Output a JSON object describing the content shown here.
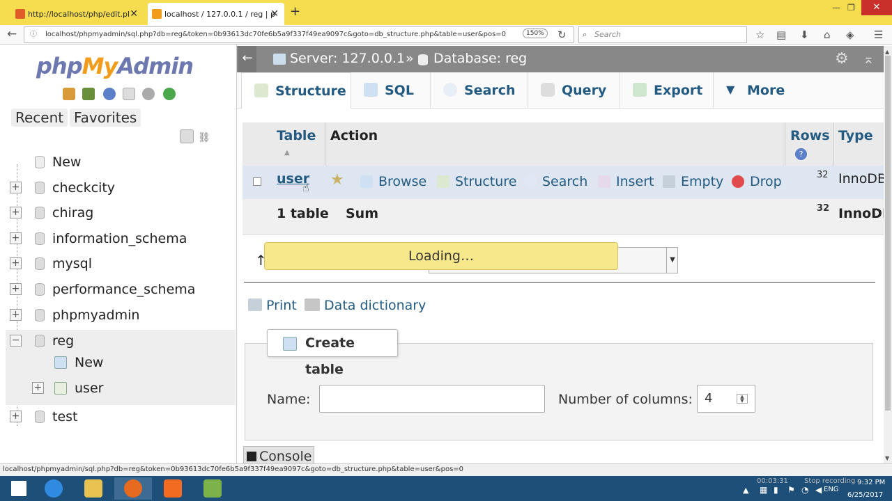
{
  "browser": {
    "tabs": [
      {
        "title": "http://localhost/php/edit.pl"
      },
      {
        "title": "localhost / 127.0.0.1 / reg | p"
      }
    ],
    "url": "localhost/phpmyadmin/sql.php?db=reg&token=0b93613dc70fe6b5a9f337f49ea9097c&goto=db_structure.php&table=user&pos=0",
    "zoom": "150%",
    "search_placeholder": "Search",
    "status_url": "localhost/phpmyadmin/sql.php?db=reg&token=0b93613dc70fe6b5a9f337f49ea9097c&goto=db_structure.php&table=user&pos=0"
  },
  "sidebar": {
    "logo": {
      "php": "php",
      "my": "My",
      "admin": "Admin"
    },
    "recent": "Recent",
    "favorites": "Favorites",
    "tree": [
      {
        "label": "New"
      },
      {
        "label": "checkcity"
      },
      {
        "label": "chirag"
      },
      {
        "label": "information_schema"
      },
      {
        "label": "mysql"
      },
      {
        "label": "performance_schema"
      },
      {
        "label": "phpmyadmin"
      },
      {
        "label": "reg"
      },
      {
        "label": "New"
      },
      {
        "label": "user"
      },
      {
        "label": "test"
      }
    ]
  },
  "breadcrumb": {
    "server": "Server: 127.0.0.1",
    "sep": "»",
    "database": "Database: reg"
  },
  "tabs": [
    {
      "label": "Structure"
    },
    {
      "label": "SQL"
    },
    {
      "label": "Search"
    },
    {
      "label": "Query"
    },
    {
      "label": "Export"
    },
    {
      "label": "More"
    }
  ],
  "table": {
    "headers": {
      "table": "Table",
      "action": "Action",
      "rows": "Rows",
      "type": "Type"
    },
    "row": {
      "name": "user",
      "actions": [
        "Browse",
        "Structure",
        "Search",
        "Insert",
        "Empty",
        "Drop"
      ],
      "rows": "32",
      "type": "InnoDB"
    },
    "footer": {
      "count": "1 table",
      "sum": "Sum",
      "rows": "32",
      "type": "InnoDB"
    }
  },
  "loading": "Loading…",
  "links": {
    "print": "Print",
    "data_dictionary": "Data dictionary"
  },
  "create_table": {
    "legend": "Create table",
    "name_label": "Name:",
    "name_value": "",
    "columns_label": "Number of columns:",
    "columns_value": "4"
  },
  "console": "Console",
  "tray": {
    "recording": "00:03:31",
    "stop": "Stop recording",
    "lang": "ENG",
    "time": "9:32 PM",
    "date": "6/25/2017"
  }
}
